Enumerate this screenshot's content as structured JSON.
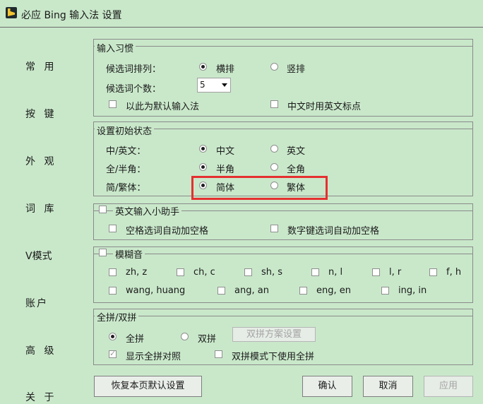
{
  "window": {
    "title": "必应 Bing 输入法 设置",
    "icon": "bing-logo-icon"
  },
  "nav": [
    "常 用",
    "按 键",
    "外 观",
    "词 库",
    "V模式",
    "账户",
    "高 级",
    "关 于"
  ],
  "input_habit": {
    "title": "输入习惯",
    "candidate_layout_label": "候选词排列：",
    "horizontal_label": "横排",
    "vertical_label": "竖排",
    "candidate_count_label": "候选词个数：",
    "candidate_count_value": "5",
    "default_ime_label": "以此为默认输入法",
    "cn_en_punct_label": "中文时用英文标点"
  },
  "initial_state": {
    "title": "设置初始状态",
    "cn_en_label": "中/英文：",
    "cn_label": "中文",
    "en_label": "英文",
    "width_label": "全/半角：",
    "half_label": "半角",
    "full_label": "全角",
    "script_label": "简/繁体：",
    "simplified_label": "简体",
    "traditional_label": "繁体"
  },
  "english_helper": {
    "title": "英文输入小助手",
    "space_select_label": "空格选词自动加空格",
    "number_select_label": "数字键选词自动加空格"
  },
  "fuzzy": {
    "title": "模糊音",
    "pairs": [
      "zh, z",
      "ch, c",
      "sh, s",
      "n, l",
      "l, r",
      "f, h",
      "wang, huang",
      "ang, an",
      "eng, en",
      "ing, in"
    ]
  },
  "pinyin_mode": {
    "title": "全拼/双拼",
    "full_label": "全拼",
    "double_label": "双拼",
    "scheme_button": "双拼方案设置",
    "show_full_label": "显示全拼对照",
    "use_full_in_double_label": "双拼模式下使用全拼"
  },
  "buttons": {
    "restore": "恢复本页默认设置",
    "ok": "确认",
    "cancel": "取消",
    "apply": "应用"
  },
  "colors": {
    "background": "#c9e8ca",
    "highlight": "#e53030"
  }
}
